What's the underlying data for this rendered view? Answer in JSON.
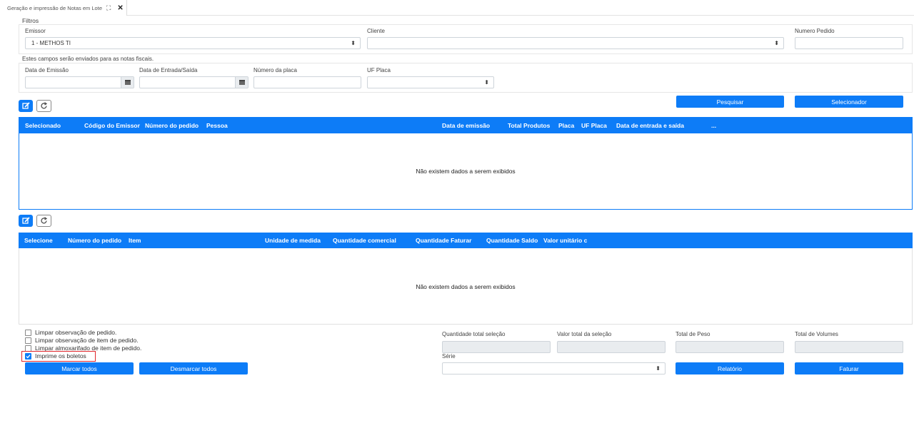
{
  "tab": {
    "title": "Geração e impressão de Notas em Lote",
    "expand_icon": "expand-icon",
    "close_icon": "close-icon",
    "close_glyph": "✕"
  },
  "filters": {
    "section_label": "Filtros",
    "emissor": {
      "label": "Emissor",
      "value": "1 - METHOS TI"
    },
    "cliente": {
      "label": "Cliente",
      "value": ""
    },
    "numero_pedido": {
      "label": "Numero Pedido",
      "value": ""
    }
  },
  "fiscal": {
    "note": "Estes campos serão enviados para as notas fiscais.",
    "data_emissao": {
      "label": "Data de Emissão",
      "value": ""
    },
    "data_entrada_saida": {
      "label": "Data de Entrada/Saída",
      "value": ""
    },
    "numero_placa": {
      "label": "Número da placa",
      "value": ""
    },
    "uf_placa": {
      "label": "UF Placa",
      "value": ""
    }
  },
  "actions": {
    "pesquisar": "Pesquisar",
    "selecionador": "Selecionador"
  },
  "grid_pedidos": {
    "columns": [
      "Selecionado",
      "Código do Emissor",
      "Número do pedido",
      "Pessoa",
      "Data de emissão",
      "Total Produtos",
      "Placa",
      "UF Placa",
      "Data de entrada e saída",
      "..."
    ],
    "empty_message": "Não existem dados a serem exibidos"
  },
  "grid_itens": {
    "columns": [
      "Selecione",
      "Número do pedido",
      "Item",
      "Unidade de medida",
      "Quantidade comercial",
      "Quantidade Faturar",
      "Quantidade Saldo",
      "Valor unitário c"
    ],
    "empty_message": "Não existem dados a serem exibidos"
  },
  "options": [
    {
      "label": "Limpar observação de pedido.",
      "checked": false
    },
    {
      "label": "Limpar observação de item de pedido.",
      "checked": false
    },
    {
      "label": "Limpar almoxarifado de item de pedido.",
      "checked": false
    },
    {
      "label": "Imprime os boletos",
      "checked": true
    }
  ],
  "bulk": {
    "marcar_todos": "Marcar todos",
    "desmarcar_todos": "Desmarcar todos"
  },
  "totals": {
    "quantidade_total": {
      "label": "Quantidade total seleção",
      "value": ""
    },
    "valor_total": {
      "label": "Valor total da seleção",
      "value": ""
    },
    "total_peso": {
      "label": "Total de Peso",
      "value": ""
    },
    "total_volumes": {
      "label": "Total de Volumes",
      "value": ""
    }
  },
  "serie": {
    "label": "Série",
    "value": ""
  },
  "footer_actions": {
    "relatorio": "Relatório",
    "faturar": "Faturar"
  },
  "colors": {
    "primary": "#0d7cf7",
    "highlight": "#e0262b"
  }
}
